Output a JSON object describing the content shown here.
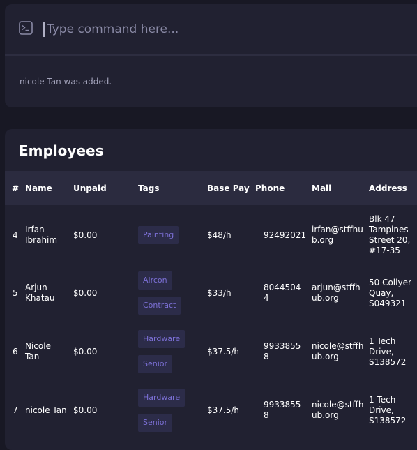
{
  "command": {
    "placeholder": "Type command here...",
    "result": "nicole Tan was added."
  },
  "employees": {
    "title": "Employees",
    "columns": [
      "#",
      "Name",
      "Unpaid",
      "Tags",
      "Base Pay",
      "Phone",
      "Mail",
      "Address"
    ],
    "rows": [
      {
        "index": "4",
        "name": [
          "Irfan",
          "Ibrahim"
        ],
        "unpaid": "$0.00",
        "tags": [
          "Painting"
        ],
        "base_pay": "$48/h",
        "phone": [
          "92492021"
        ],
        "mail": [
          "irfan@stffhu",
          "b.org"
        ],
        "address": [
          "Blk 47",
          "Tampines",
          "Street 20,",
          "#17-35"
        ]
      },
      {
        "index": "5",
        "name": [
          "Arjun",
          "Khatau"
        ],
        "unpaid": "$0.00",
        "tags": [
          "Aircon",
          "Contract"
        ],
        "base_pay": "$33/h",
        "phone": [
          "8044504",
          "4"
        ],
        "mail": [
          "arjun@stffh",
          "ub.org"
        ],
        "address": [
          "50 Collyer",
          "Quay,",
          "S049321"
        ]
      },
      {
        "index": "6",
        "name": [
          "Nicole",
          "Tan"
        ],
        "unpaid": "$0.00",
        "tags": [
          "Hardware",
          "Senior"
        ],
        "base_pay": "$37.5/h",
        "phone": [
          "9933855",
          "8"
        ],
        "mail": [
          "nicole@stffh",
          "ub.org"
        ],
        "address": [
          "1 Tech",
          "Drive,",
          "S138572"
        ]
      },
      {
        "index": "7",
        "name": [
          "nicole Tan"
        ],
        "unpaid": "$0.00",
        "tags": [
          "Hardware",
          "Senior"
        ],
        "base_pay": "$37.5/h",
        "phone": [
          "9933855",
          "8"
        ],
        "mail": [
          "nicole@stffh",
          "ub.org"
        ],
        "address": [
          "1 Tech",
          "Drive,",
          "S138572"
        ]
      }
    ]
  },
  "colors": {
    "background": "#181824",
    "panel": "#212131",
    "header": "#2b2b3f",
    "tag_bg": "#2c2c49",
    "tag_text": "#7c70d6"
  }
}
